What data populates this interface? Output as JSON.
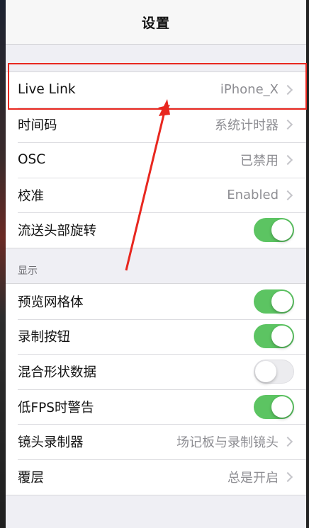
{
  "nav": {
    "title": "设置"
  },
  "group1": [
    {
      "label": "Live Link",
      "value": "iPhone_X",
      "type": "disclosure"
    },
    {
      "label": "时间码",
      "value": "系统计时器",
      "type": "disclosure"
    },
    {
      "label": "OSC",
      "value": "已禁用",
      "type": "disclosure"
    },
    {
      "label": "校准",
      "value": "Enabled",
      "type": "disclosure"
    },
    {
      "label": "流送头部旋转",
      "type": "toggle",
      "on": true
    }
  ],
  "display_section": {
    "header": "显示",
    "rows": [
      {
        "label": "预览网格体",
        "type": "toggle",
        "on": true
      },
      {
        "label": "录制按钮",
        "type": "toggle",
        "on": true
      },
      {
        "label": "混合形状数据",
        "type": "toggle",
        "on": false
      },
      {
        "label": "低FPS时警告",
        "type": "toggle",
        "on": true
      },
      {
        "label": "镜头录制器",
        "value": "场记板与录制镜头",
        "type": "disclosure"
      },
      {
        "label": "覆层",
        "value": "总是开启",
        "type": "disclosure"
      }
    ]
  },
  "colors": {
    "toggle_on": "#5cc462",
    "annotation": "#e8271f"
  }
}
